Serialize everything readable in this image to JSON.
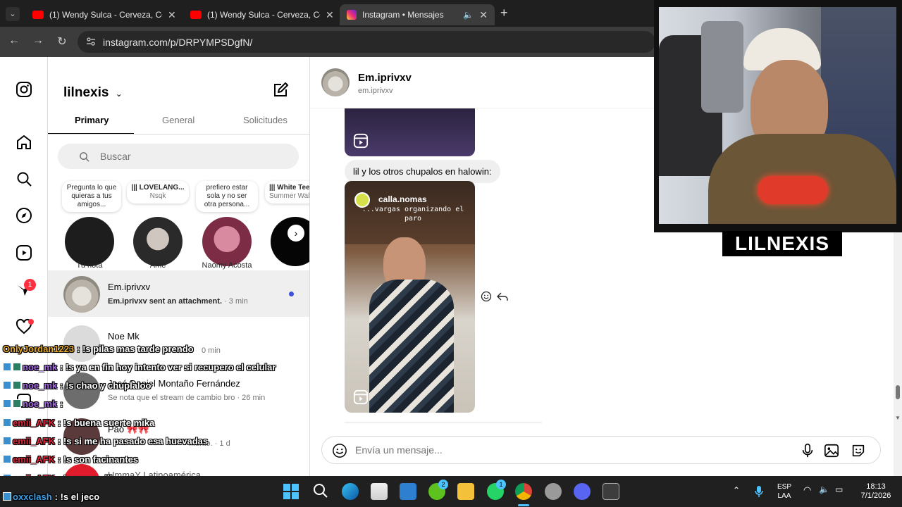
{
  "browser": {
    "tabs": [
      {
        "title": "(1) Wendy Sulca - Cerveza, Cerv",
        "favicon": "youtube-icon"
      },
      {
        "title": "(1) Wendy Sulca - Cerveza, Cerv",
        "favicon": "youtube-icon"
      },
      {
        "title": "Instagram • Mensajes",
        "favicon": "instagram-icon"
      }
    ],
    "new_tab": "+",
    "url": "instagram.com/p/DRPYMPSDgfN/"
  },
  "inbox": {
    "account": "lilnexis",
    "tabs": [
      "Primary",
      "General",
      "Solicitudes"
    ],
    "search_placeholder": "Buscar",
    "notes": [
      {
        "text": "Pregunta lo que quieras a tus amigos...",
        "name": "Tu nota"
      },
      {
        "text": "||| LOVELANG...",
        "sub": "Nsqk",
        "name": "Ame"
      },
      {
        "text": "prefiero estar sola y no ser otra persona...",
        "name": "Naomy Acosta"
      },
      {
        "text": "||| White Tee",
        "sub": "Summer Wal",
        "name": ""
      }
    ],
    "nav_badge": "1",
    "conversations": [
      {
        "name": "Em.iprivxv",
        "preview": "Em.iprivxv sent an attachment.",
        "time": "· 3 min"
      },
      {
        "name": "Noe Mk",
        "preview": "",
        "time": "0 min"
      },
      {
        "name": "José Daniel Montaño Fernández",
        "preview": "Se nota que el stream de cambio bro",
        "time": "· 26 min"
      },
      {
        "name": "Pao 🎀🎀",
        "preview": "...unto.",
        "time": "· 1 d"
      },
      {
        "name": "UmmaY Latinoamérica",
        "preview": "",
        "time": ""
      }
    ]
  },
  "chat": {
    "name": "Em.iprivxv",
    "username": "em.iprivxv",
    "message_text": "lil y los otros chupalos en halowin:",
    "reel_account": "calla.nomas",
    "reel_caption": "...vargas organizando el paro",
    "input_placeholder": "Envía un mensaje..."
  },
  "webcam": {
    "streamer_name": "LILNEXIS"
  },
  "stream_chat": [
    {
      "user": "OnlyJordan1223",
      "text": ": !s pilas mas tarde prendo",
      "color": "#e6a92a"
    },
    {
      "user": "noe_mk",
      "text": ": !s ya en fin hoy intento ver si recupero el celular",
      "color": "#a56ce4"
    },
    {
      "user": "noe_mk",
      "text": ": !s chao y chuplaloo",
      "color": "#a56ce4"
    },
    {
      "user": "noe_mk",
      "text": ":",
      "color": "#a56ce4"
    },
    {
      "user": "emii_AFK",
      "text": ": !s buena suerte mika",
      "color": "#e0263a"
    },
    {
      "user": "emii_AFK",
      "text": ": !s si me ha pasado esa huevadas",
      "color": "#e0263a"
    },
    {
      "user": "emii_AFK",
      "text": ": !s son facinantes",
      "color": "#e0263a"
    },
    {
      "user": "emii_AFK",
      "text": ": !s ese es lil",
      "color": "#e0263a"
    },
    {
      "user": "oxxclash",
      "text": ": !s el jeco",
      "color": "#3aa0e8"
    }
  ],
  "taskbar": {
    "lang_top": "ESP",
    "lang_bottom": "LAA",
    "time": "18:13",
    "date": "7/1/2026",
    "whatsapp_badge": "1",
    "xbox_badge": "2"
  },
  "colors": {
    "unread_dot": "#3f51d6",
    "notification_red": "#ff3040"
  }
}
